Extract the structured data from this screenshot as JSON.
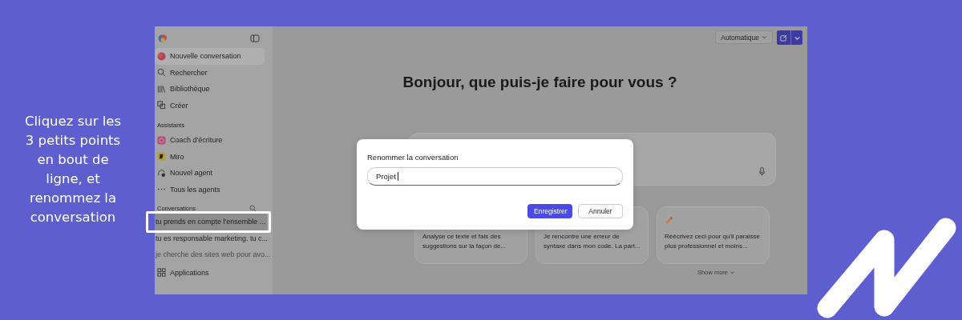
{
  "caption": "Cliquez sur les\n3 petits points\nen bout de\nligne, et\nrenommez la\nconversation",
  "sidebar": {
    "nav": [
      {
        "kind": "new-chat",
        "label": "Nouvelle conversation",
        "selected": true
      },
      {
        "kind": "search",
        "label": "Rechercher",
        "selected": false
      },
      {
        "kind": "library",
        "label": "Bibliothèque",
        "selected": false
      },
      {
        "kind": "create",
        "label": "Créer",
        "selected": false
      }
    ],
    "assistants_heading": "Assistants",
    "assistants": [
      {
        "kind": "coach",
        "label": "Coach d'écriture"
      },
      {
        "kind": "miro",
        "label": "Miro"
      },
      {
        "kind": "agent",
        "label": "Nouvel agent"
      },
      {
        "kind": "more",
        "label": "Tous les agents"
      }
    ],
    "conversations_heading": "Conversations",
    "conversations": [
      {
        "label": "tu prends en compte l'ensemble ...",
        "selected": true,
        "annotated": true,
        "faded": false
      },
      {
        "label": "tu es responsable marketing. tu c...",
        "selected": false,
        "annotated": false,
        "faded": false
      },
      {
        "label": "je cherche des sites web pour avo...",
        "selected": false,
        "annotated": false,
        "faded": true
      }
    ],
    "footer": {
      "kind": "apps",
      "label": "Applications"
    }
  },
  "toolbar": {
    "mode": "Automatique"
  },
  "greeting": "Bonjour, que puis-je faire pour vous ?",
  "suggestions": [
    {
      "kind": "text",
      "lines": [
        "Analyse ce texte et fais des",
        "suggestions sur la façon de..."
      ]
    },
    {
      "kind": "text",
      "lines": [
        "Je rencontre une erreur de",
        "syntaxe dans mon code. La part..."
      ]
    },
    {
      "kind": "pencil",
      "lines": [
        "Réécrivez ceci pour qu'il paraisse",
        "plus professionnel et moins..."
      ]
    }
  ],
  "show_more": "Show more",
  "dialog": {
    "title": "Renommer la conversation",
    "value": "Projet",
    "buttons": [
      {
        "kind": "primary",
        "label": "Enregistrer"
      },
      {
        "kind": "secondary",
        "label": "Annuler"
      }
    ]
  }
}
